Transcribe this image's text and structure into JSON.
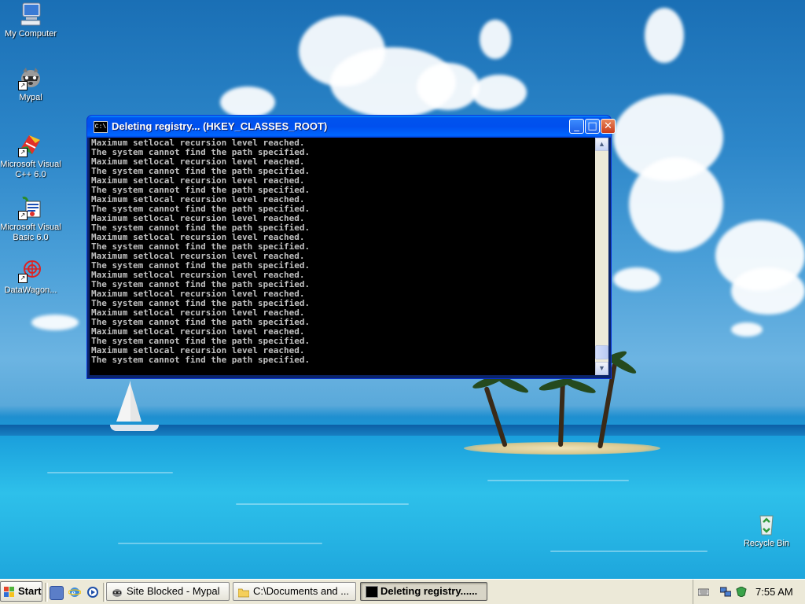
{
  "desktop": {
    "icons": [
      {
        "label": "My Computer",
        "icon": "my-computer-icon"
      },
      {
        "label": "Mypal",
        "icon": "mypal-raccoon-icon"
      },
      {
        "label": "Microsoft Visual C++ 6.0",
        "icon": "visual-cpp-icon"
      },
      {
        "label": "Microsoft Visual Basic 6.0",
        "icon": "visual-basic-icon"
      },
      {
        "label": "DataWagon...",
        "icon": "datawagon-icon"
      },
      {
        "label": "Recycle Bin",
        "icon": "recycle-bin-icon"
      }
    ]
  },
  "console_window": {
    "title": "Deleting registry... (HKEY_CLASSES_ROOT)",
    "icon_text": "C:\\",
    "buttons": {
      "minimize": "_",
      "maximize": "□",
      "close": "✕"
    },
    "lines": [
      "Maximum setlocal recursion level reached.",
      "The system cannot find the path specified.",
      "Maximum setlocal recursion level reached.",
      "The system cannot find the path specified.",
      "Maximum setlocal recursion level reached.",
      "The system cannot find the path specified.",
      "Maximum setlocal recursion level reached.",
      "The system cannot find the path specified.",
      "Maximum setlocal recursion level reached.",
      "The system cannot find the path specified.",
      "Maximum setlocal recursion level reached.",
      "The system cannot find the path specified.",
      "Maximum setlocal recursion level reached.",
      "The system cannot find the path specified.",
      "Maximum setlocal recursion level reached.",
      "The system cannot find the path specified.",
      "Maximum setlocal recursion level reached.",
      "The system cannot find the path specified.",
      "Maximum setlocal recursion level reached.",
      "The system cannot find the path specified.",
      "Maximum setlocal recursion level reached.",
      "The system cannot find the path specified.",
      "Maximum setlocal recursion level reached.",
      "The system cannot find the path specified."
    ],
    "scroll_up": "▲",
    "scroll_down": "▼"
  },
  "taskbar": {
    "start_label": "Start",
    "quick_launch": [
      "show-desktop-icon",
      "internet-explorer-icon",
      "media-player-icon"
    ],
    "tasks": [
      {
        "label": "Site Blocked - Mypal",
        "icon": "mypal-raccoon-icon",
        "active": false
      },
      {
        "label": "C:\\Documents and ...",
        "icon": "folder-icon",
        "active": false
      },
      {
        "label": "Deleting registry......",
        "icon": "console-icon",
        "active": true
      }
    ],
    "tray_icons": [
      "keyboard-icon",
      "network-icon",
      "security-icon"
    ],
    "clock": "7:55 AM"
  },
  "colors": {
    "titlebar": "#0054e3",
    "console_bg": "#000000",
    "console_text": "#c0c0c0",
    "taskbar_bg": "#ece9d8",
    "close_button": "#c83c1c"
  }
}
